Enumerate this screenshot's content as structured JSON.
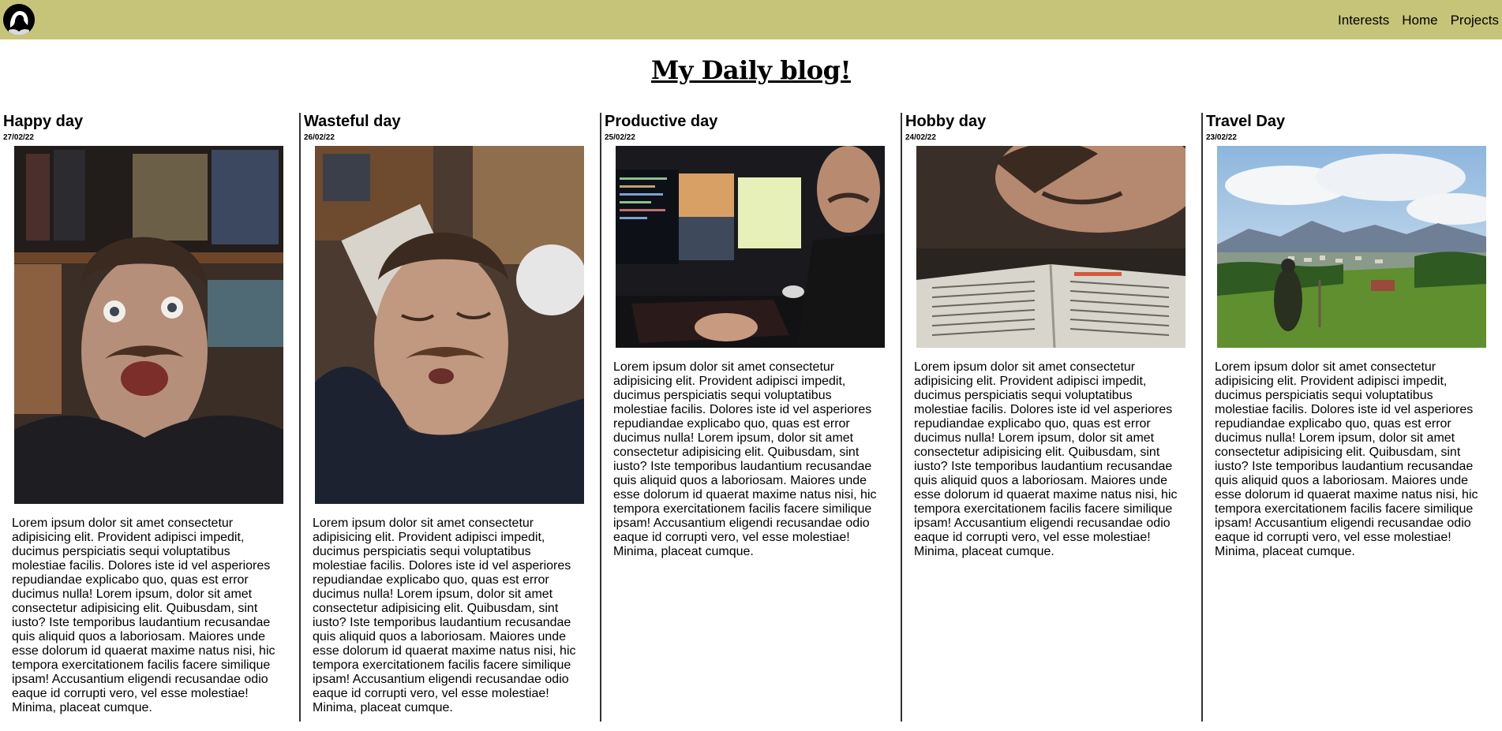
{
  "colors": {
    "nav_bg": "#c6c478",
    "page_bg": "#ffffff",
    "divider": "#333333"
  },
  "header": {
    "logo_icon": "silhouette-portrait-icon",
    "nav": [
      {
        "label": "Interests"
      },
      {
        "label": "Home"
      },
      {
        "label": "Projects"
      }
    ]
  },
  "page": {
    "title": "My Daily blog!"
  },
  "posts": [
    {
      "title": "Happy day",
      "date": "27/02/22",
      "photo": "happy-selfie-photo",
      "body": "Lorem ipsum dolor sit amet consectetur adipisicing elit. Provident adipisci impedit, ducimus perspiciatis sequi voluptatibus molestiae facilis. Dolores iste id vel asperiores repudiandae explicabo quo, quas est error ducimus nulla! Lorem ipsum, dolor sit amet consectetur adipisicing elit. Quibusdam, sint iusto? Iste temporibus laudantium recusandae quis aliquid quos a laboriosam. Maiores unde esse dolorum id quaerat maxime natus nisi, hic tempora exercitationem facilis facere similique ipsam! Accusantium eligendi recusandae odio eaque id corrupti vero, vel esse molestiae! Minima, placeat cumque."
    },
    {
      "title": "Wasteful day",
      "date": "26/02/22",
      "photo": "sleepy-selfie-photo",
      "body": "Lorem ipsum dolor sit amet consectetur adipisicing elit. Provident adipisci impedit, ducimus perspiciatis sequi voluptatibus molestiae facilis. Dolores iste id vel asperiores repudiandae explicabo quo, quas est error ducimus nulla! Lorem ipsum, dolor sit amet consectetur adipisicing elit. Quibusdam, sint iusto? Iste temporibus laudantium recusandae quis aliquid quos a laboriosam. Maiores unde esse dolorum id quaerat maxime natus nisi, hic tempora exercitationem facilis facere similique ipsam! Accusantium eligendi recusandae odio eaque id corrupti vero, vel esse molestiae! Minima, placeat cumque."
    },
    {
      "title": "Productive day",
      "date": "25/02/22",
      "photo": "computer-desk-photo",
      "body": "Lorem ipsum dolor sit amet consectetur adipisicing elit. Provident adipisci impedit, ducimus perspiciatis sequi voluptatibus molestiae facilis. Dolores iste id vel asperiores repudiandae explicabo quo, quas est error ducimus nulla! Lorem ipsum, dolor sit amet consectetur adipisicing elit. Quibusdam, sint iusto? Iste temporibus laudantium recusandae quis aliquid quos a laboriosam. Maiores unde esse dolorum id quaerat maxime natus nisi, hic tempora exercitationem facilis facere similique ipsam! Accusantium eligendi recusandae odio eaque id corrupti vero, vel esse molestiae! Minima, placeat cumque."
    },
    {
      "title": "Hobby day",
      "date": "24/02/22",
      "photo": "reading-book-photo",
      "body": "Lorem ipsum dolor sit amet consectetur adipisicing elit. Provident adipisci impedit, ducimus perspiciatis sequi voluptatibus molestiae facilis. Dolores iste id vel asperiores repudiandae explicabo quo, quas est error ducimus nulla! Lorem ipsum, dolor sit amet consectetur adipisicing elit. Quibusdam, sint iusto? Iste temporibus laudantium recusandae quis aliquid quos a laboriosam. Maiores unde esse dolorum id quaerat maxime natus nisi, hic tempora exercitationem facilis facere similique ipsam! Accusantium eligendi recusandae odio eaque id corrupti vero, vel esse molestiae! Minima, placeat cumque."
    },
    {
      "title": "Travel Day",
      "date": "23/02/22",
      "photo": "mountain-landscape-photo",
      "body": "Lorem ipsum dolor sit amet consectetur adipisicing elit. Provident adipisci impedit, ducimus perspiciatis sequi voluptatibus molestiae facilis. Dolores iste id vel asperiores repudiandae explicabo quo, quas est error ducimus nulla! Lorem ipsum, dolor sit amet consectetur adipisicing elit. Quibusdam, sint iusto? Iste temporibus laudantium recusandae quis aliquid quos a laboriosam. Maiores unde esse dolorum id quaerat maxime natus nisi, hic tempora exercitationem facilis facere similique ipsam! Accusantium eligendi recusandae odio eaque id corrupti vero, vel esse molestiae! Minima, placeat cumque."
    }
  ]
}
